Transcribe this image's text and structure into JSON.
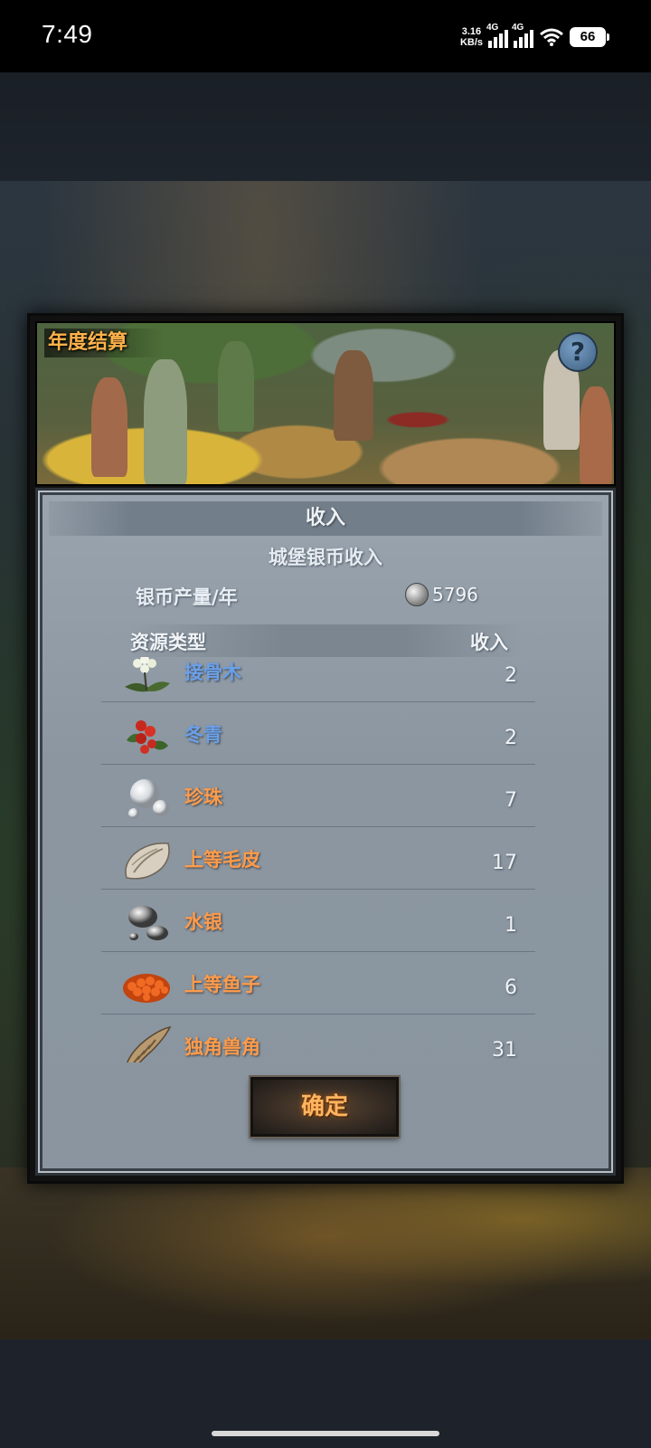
{
  "status_bar": {
    "time": "7:49",
    "net_speed_value": "3.16",
    "net_speed_unit": "KB/s",
    "signal1_label": "4G",
    "signal2_label": "4G",
    "battery": "66"
  },
  "dialog": {
    "title": "年度结算",
    "help_label": "?",
    "section_header": "收入",
    "subtitle": "城堡银币收入",
    "coin_label": "银币产量/年",
    "coin_value": "5796",
    "col_type": "资源类型",
    "col_income": "收入",
    "items": [
      {
        "name": "接骨木",
        "value": "2",
        "color": "#6ba0ea",
        "icon": "elderberry-icon"
      },
      {
        "name": "冬青",
        "value": "2",
        "color": "#6ba0ea",
        "icon": "holly-icon"
      },
      {
        "name": "珍珠",
        "value": "7",
        "color": "#ff9b4a",
        "icon": "pearl-icon"
      },
      {
        "name": "上等毛皮",
        "value": "17",
        "color": "#ff9b4a",
        "icon": "fur-icon"
      },
      {
        "name": "水银",
        "value": "1",
        "color": "#ff9b4a",
        "icon": "mercury-icon"
      },
      {
        "name": "上等鱼子",
        "value": "6",
        "color": "#ff9b4a",
        "icon": "caviar-icon"
      },
      {
        "name": "独角兽角",
        "value": "31",
        "color": "#ff9b4a",
        "icon": "unicorn-horn-icon"
      }
    ],
    "confirm_label": "确定"
  }
}
